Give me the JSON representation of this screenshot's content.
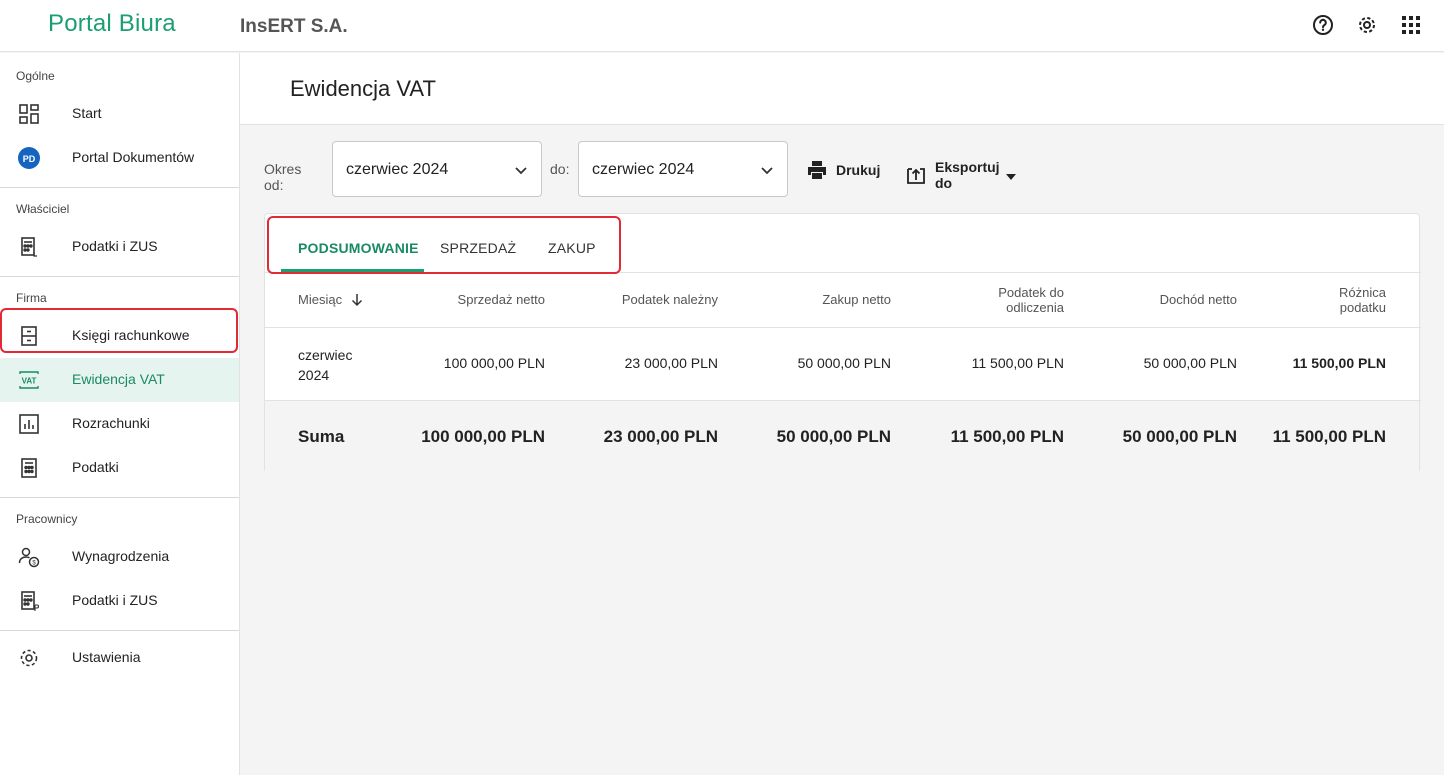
{
  "app": {
    "logo_part1": "Portal",
    "logo_part2": "Biura",
    "company": "InsERT S.A."
  },
  "topbar": {
    "icons": [
      "help-icon",
      "gear-icon",
      "apps-grid-icon"
    ]
  },
  "sidebar": {
    "sections": [
      {
        "label": "Ogólne",
        "items": [
          {
            "label": "Start",
            "icon": "dashboard-icon"
          },
          {
            "label": "Portal Dokumentów",
            "icon": "pd-badge-icon",
            "badge": "PD"
          }
        ]
      },
      {
        "label": "Właściciel",
        "items": [
          {
            "label": "Podatki i ZUS",
            "icon": "calculator-icon"
          }
        ]
      },
      {
        "label": "Firma",
        "items": [
          {
            "label": "Księgi rachunkowe",
            "icon": "ledger-icon"
          },
          {
            "label": "Ewidencja VAT",
            "icon": "vat-icon",
            "active": true
          },
          {
            "label": "Rozrachunki",
            "icon": "bar-chart-icon"
          },
          {
            "label": "Podatki",
            "icon": "calculator-icon"
          }
        ]
      },
      {
        "label": "Pracownicy",
        "items": [
          {
            "label": "Wynagrodzenia",
            "icon": "person-money-icon"
          },
          {
            "label": "Podatki i ZUS",
            "icon": "calculator-icon"
          }
        ]
      },
      {
        "label": "",
        "items": [
          {
            "label": "Ustawienia",
            "icon": "gear-icon"
          }
        ]
      }
    ],
    "vat_icon_text": "VAT"
  },
  "page": {
    "title": "Ewidencja VAT"
  },
  "filters": {
    "from_label": "Okres od:",
    "from_value": "czerwiec 2024",
    "to_label": "do:",
    "to_value": "czerwiec 2024",
    "print_label": "Drukuj",
    "export_label": "Eksportuj do"
  },
  "tabs": [
    {
      "label": "PODSUMOWANIE",
      "active": true
    },
    {
      "label": "SPRZEDAŻ"
    },
    {
      "label": "ZAKUP"
    }
  ],
  "table": {
    "headers": {
      "month": "Miesiąc",
      "sales_net": "Sprzedaż netto",
      "tax_due": "Podatek należny",
      "purchase_net": "Zakup netto",
      "tax_deductible_1": "Podatek do",
      "tax_deductible_2": "odliczenia",
      "income_net": "Dochód netto",
      "tax_diff_1": "Różnica",
      "tax_diff_2": "podatku"
    },
    "rows": [
      {
        "month_1": "czerwiec",
        "month_2": "2024",
        "sales_net": "100 000,00 PLN",
        "tax_due": "23 000,00 PLN",
        "purchase_net": "50 000,00 PLN",
        "tax_deductible": "11 500,00 PLN",
        "income_net": "50 000,00 PLN",
        "tax_diff": "11 500,00 PLN"
      }
    ],
    "sum": {
      "label": "Suma",
      "sales_net": "100 000,00 PLN",
      "tax_due": "23 000,00 PLN",
      "purchase_net": "50 000,00 PLN",
      "tax_deductible": "11 500,00 PLN",
      "income_net": "50 000,00 PLN",
      "tax_diff": "11 500,00 PLN"
    }
  },
  "colors": {
    "brand": "#1a9f73",
    "active_bg": "#e5f4ee",
    "highlight": "#e22a35"
  }
}
